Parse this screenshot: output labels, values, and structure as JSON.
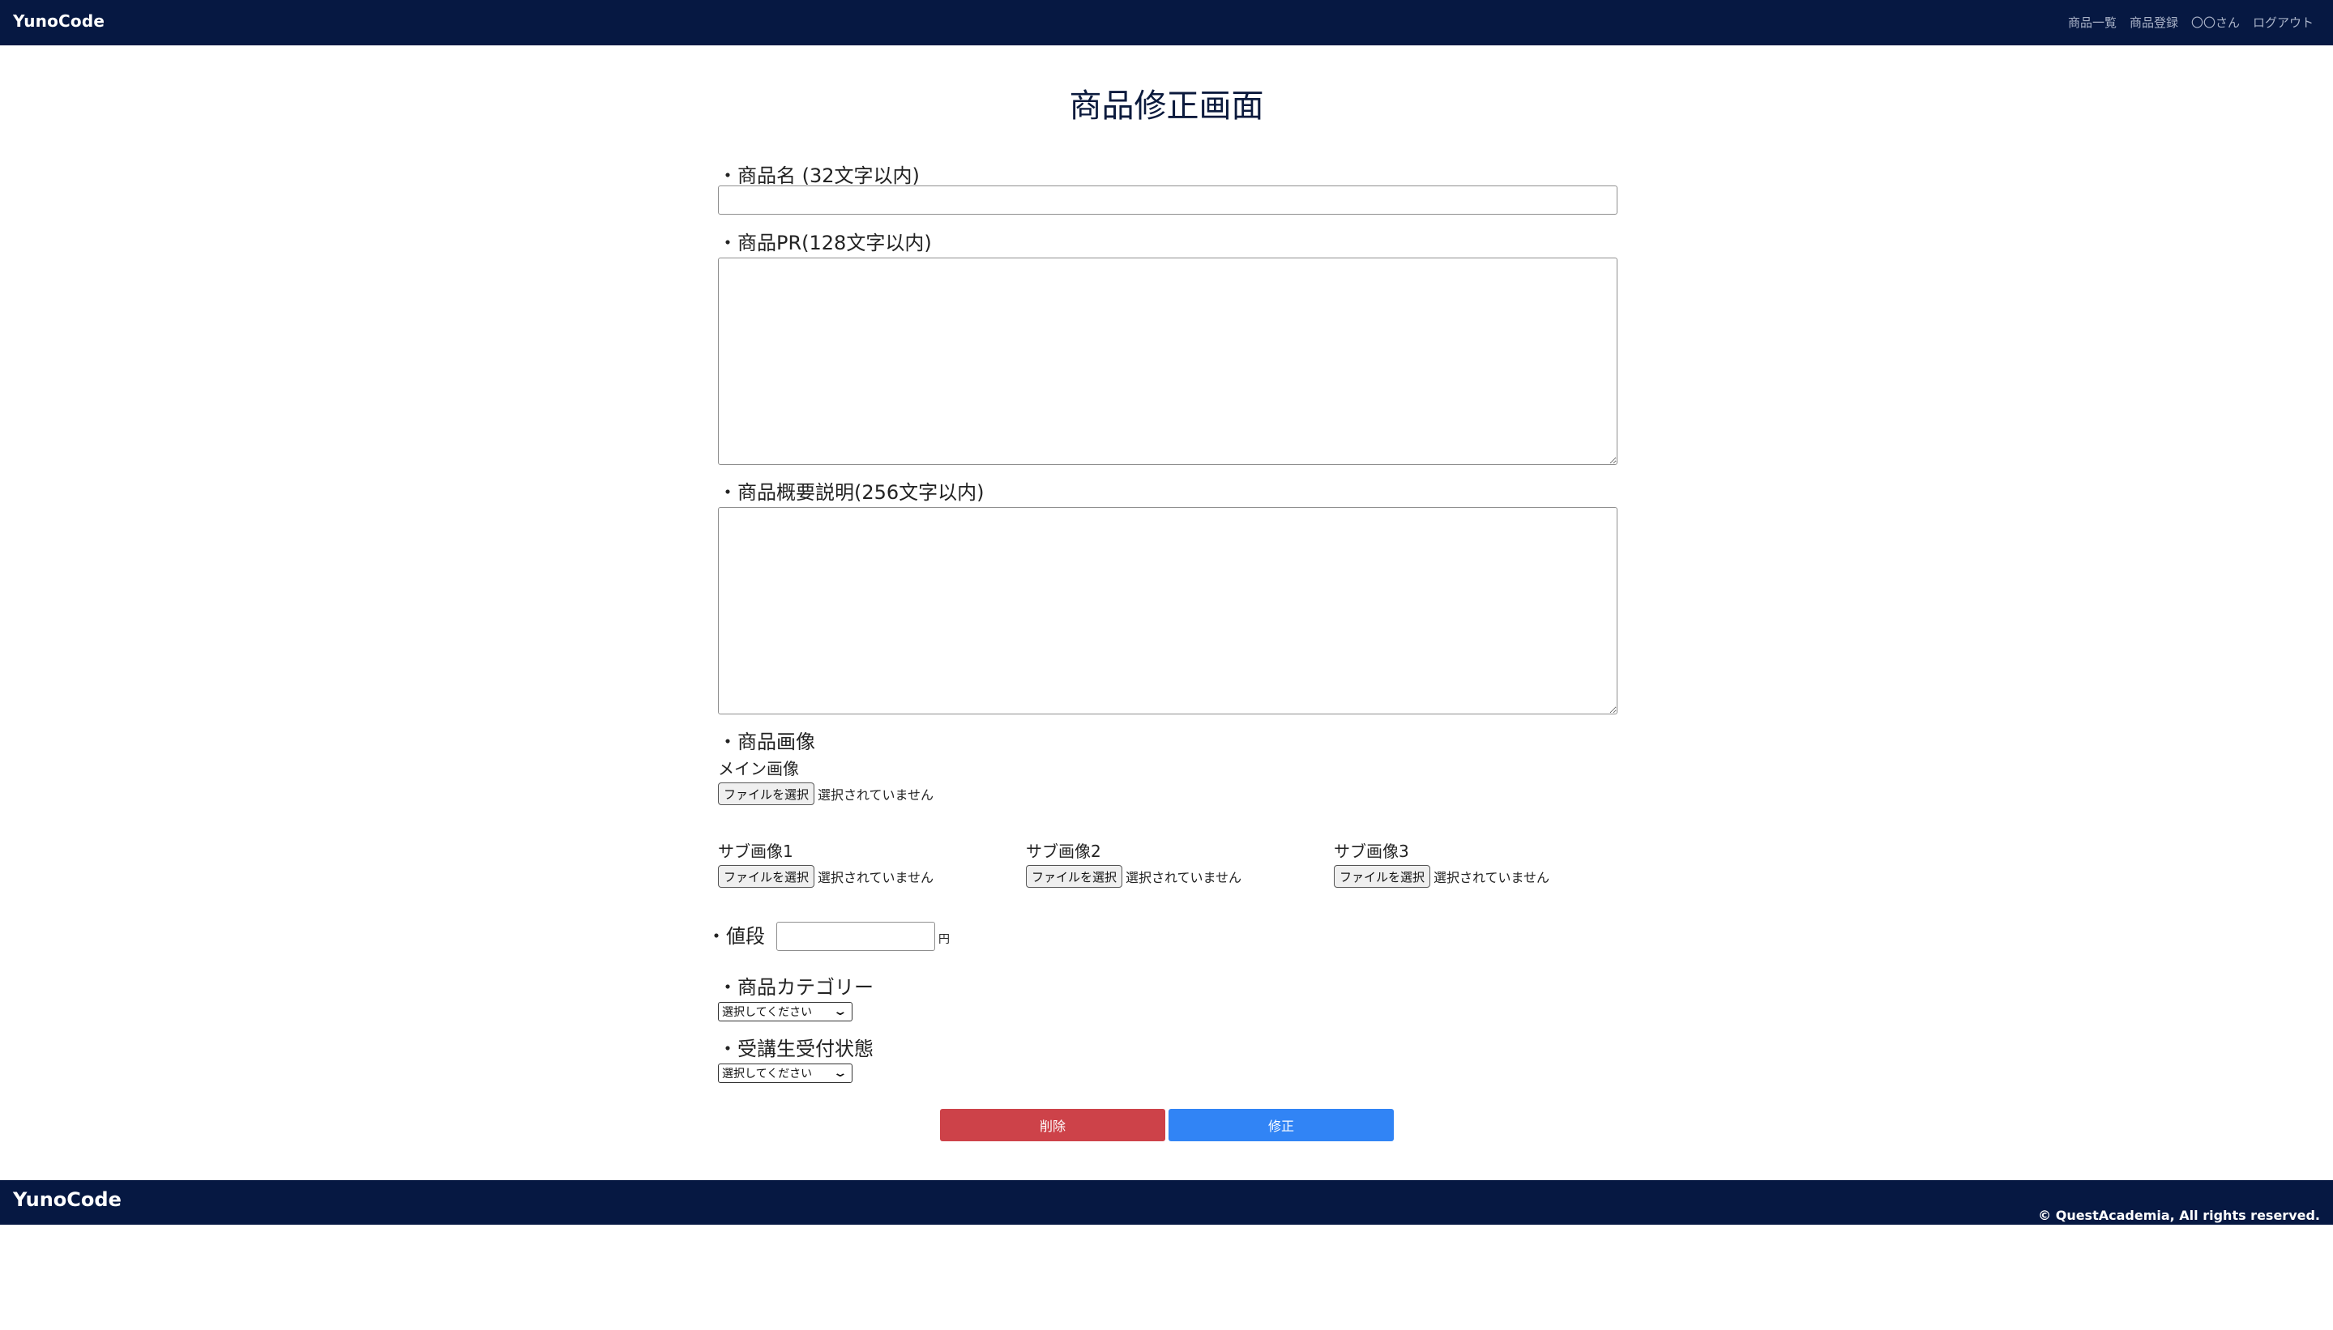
{
  "header": {
    "brand": "YunoCode",
    "nav": [
      "商品一覧",
      "商品登録",
      "〇〇さん",
      "ログアウト"
    ]
  },
  "page": {
    "title": "商品修正画面"
  },
  "form": {
    "name_label": "・商品名 (32文字以内)",
    "name_value": "",
    "pr_label": "・商品PR(128文字以内)",
    "pr_value": "",
    "desc_label": "・商品概要説明(256文字以内)",
    "desc_value": "",
    "image_label": "・商品画像",
    "main_image_label": "メイン画像",
    "file_button": "ファイルを選択",
    "file_status": "選択されていません",
    "sub_images": [
      "サブ画像1",
      "サブ画像2",
      "サブ画像3"
    ],
    "price_label": "・値段",
    "price_value": "",
    "price_unit": "円",
    "category_label": "・商品カテゴリー",
    "category_selected": "選択してください",
    "status_label": "・受講生受付状態",
    "status_selected": "選択してください",
    "delete_button": "削除",
    "update_button": "修正"
  },
  "footer": {
    "brand": "YunoCode",
    "copyright": "© QuestAcademia, All rights reserved."
  },
  "colors": {
    "navy": "#061842",
    "delete": "#cd4249",
    "update": "#3184f5"
  }
}
